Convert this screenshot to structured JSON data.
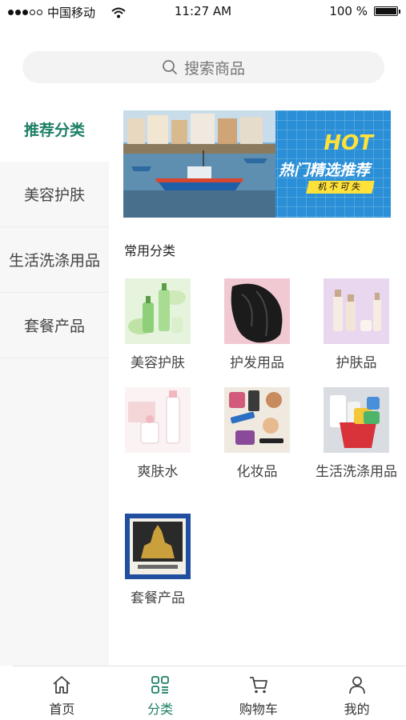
{
  "status_bar": {
    "carrier": "中国移动",
    "time": "11:27 AM",
    "battery_percent": "100 %"
  },
  "search": {
    "placeholder": "搜索商品",
    "icon": "search-icon"
  },
  "sidebar": {
    "items": [
      {
        "label": "推荐分类",
        "active": true
      },
      {
        "label": "美容护肤",
        "active": false
      },
      {
        "label": "生活洗涤用品",
        "active": false
      },
      {
        "label": "套餐产品",
        "active": false
      }
    ]
  },
  "banner": {
    "hot": "HOT",
    "title": "热门精选推荐",
    "tag": "机不可失"
  },
  "section": {
    "title": "常用分类"
  },
  "categories": [
    {
      "label": "美容护肤"
    },
    {
      "label": "护发用品"
    },
    {
      "label": "护肤品"
    },
    {
      "label": "爽肤水"
    },
    {
      "label": "化妆品"
    },
    {
      "label": "生活洗涤用品"
    },
    {
      "label": "套餐产品"
    }
  ],
  "tabbar": {
    "tabs": [
      {
        "label": "首页",
        "icon": "home-icon",
        "active": false
      },
      {
        "label": "分类",
        "icon": "category-icon",
        "active": true
      },
      {
        "label": "购物车",
        "icon": "cart-icon",
        "active": false
      },
      {
        "label": "我的",
        "icon": "user-icon",
        "active": false
      }
    ]
  },
  "colors": {
    "accent": "#1e7f66",
    "banner_blue": "#2a8fd6",
    "banner_yellow": "#ffe13b"
  }
}
